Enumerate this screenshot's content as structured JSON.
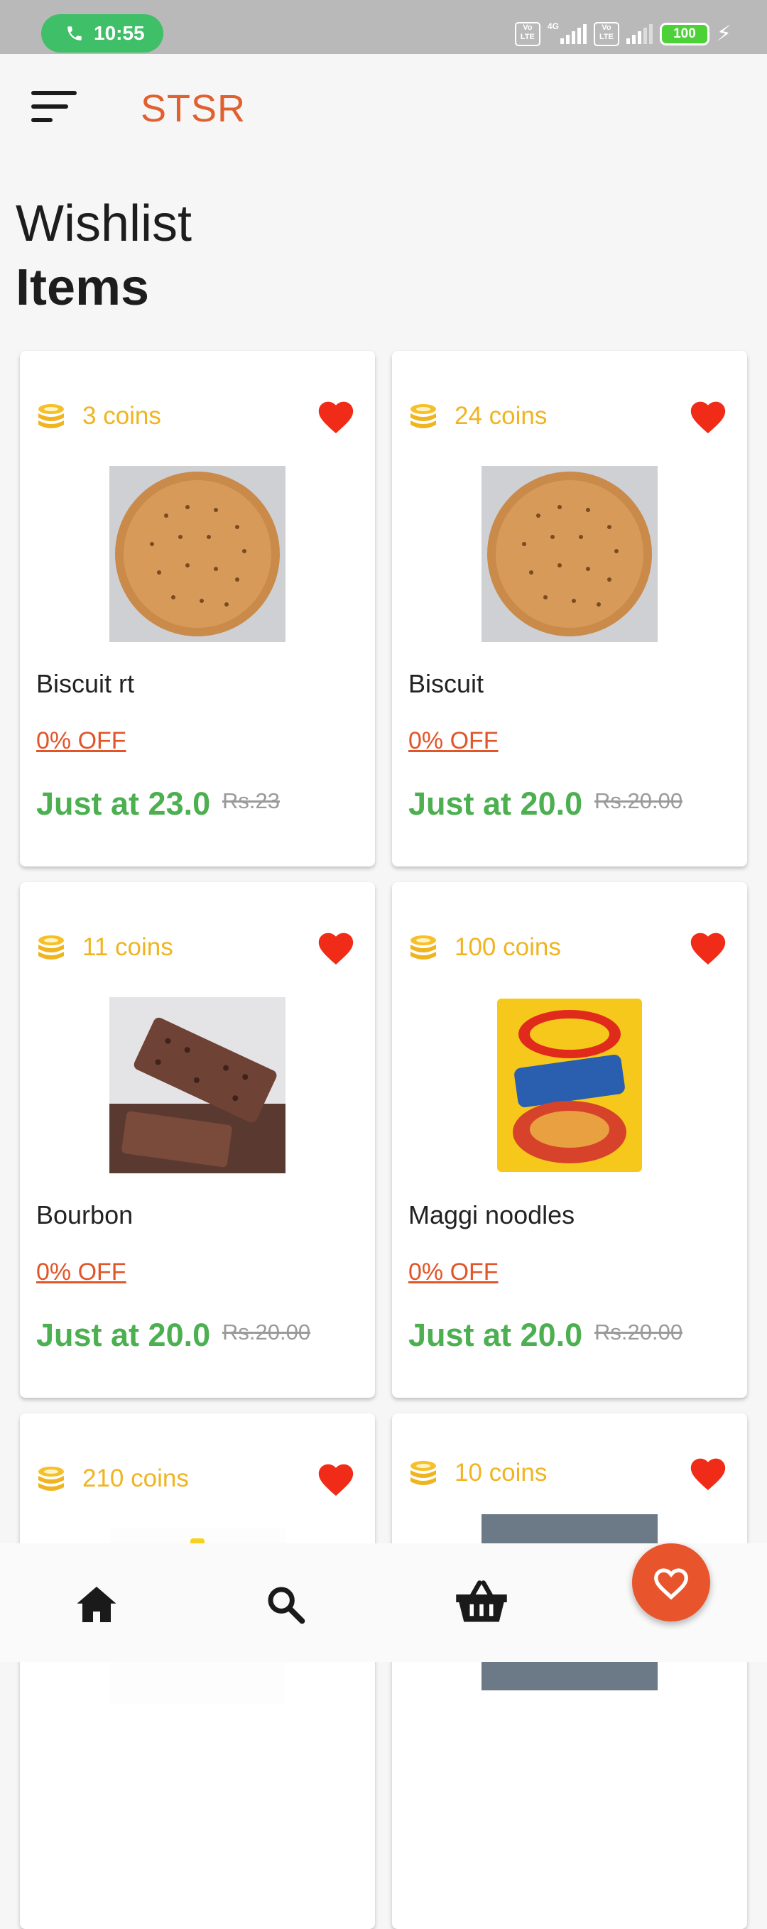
{
  "status_bar": {
    "time": "10:55",
    "battery": "100",
    "volte_label": "Vo LTE",
    "network_label": "4G"
  },
  "app_bar": {
    "brand": "STSR",
    "menu_icon": "menu-icon"
  },
  "page": {
    "title_line1": "Wishlist",
    "title_line2": "Items"
  },
  "products": [
    {
      "coins": "3 coins",
      "name": "Biscuit rt",
      "discount": "0% OFF",
      "price": "Just at 23.0",
      "mrp": "Rs.23",
      "image": "rich-tea-biscuit"
    },
    {
      "coins": "24 coins",
      "name": "Biscuit",
      "discount": "0% OFF",
      "price": "Just at 20.0",
      "mrp": "Rs.20.00",
      "image": "rich-tea-biscuit"
    },
    {
      "coins": "11 coins",
      "name": "Bourbon",
      "discount": "0% OFF",
      "price": "Just at 20.0",
      "mrp": "Rs.20.00",
      "image": "bourbon-biscuit"
    },
    {
      "coins": "100 coins",
      "name": "Maggi noodles",
      "discount": "0% OFF",
      "price": "Just at 20.0",
      "mrp": "Rs.20.00",
      "image": "maggi-noodles-pack"
    },
    {
      "coins": "210 coins",
      "name": "",
      "discount": "",
      "price": "",
      "mrp": "",
      "image": "product"
    },
    {
      "coins": "10 coins",
      "name": "",
      "discount": "",
      "price": "",
      "mrp": "",
      "image": "product"
    }
  ],
  "bottom_nav": {
    "items": [
      "home-icon",
      "search-icon",
      "basket-icon"
    ],
    "fab": "heart-outline-icon"
  },
  "colors": {
    "accent": "#e8552c",
    "coins": "#f0b420",
    "price": "#4caf50",
    "heart": "#f02c18"
  }
}
